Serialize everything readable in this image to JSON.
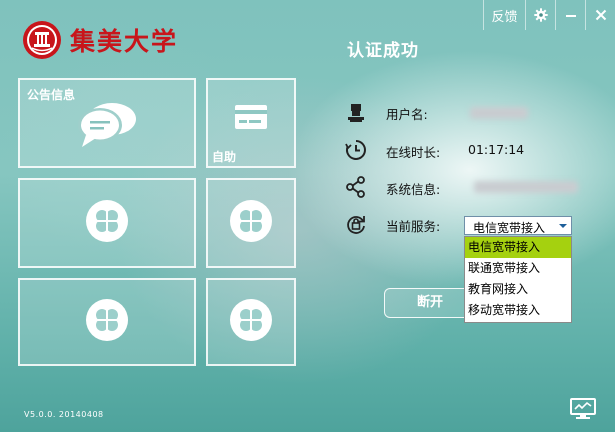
{
  "window": {
    "feedback_label": "反馈",
    "settings_icon": "gear-icon",
    "minimize_icon": "minimize-icon",
    "close_icon": "close-icon"
  },
  "brand": {
    "university_name": "集美大学",
    "seal_color": "#c8151b"
  },
  "tiles": {
    "notice_label": "公告信息",
    "self_service_label": "自助",
    "placeholder_icon": "clover-icon"
  },
  "status": {
    "title": "认证成功",
    "username_label": "用户名:",
    "online_time_label": "在线时长:",
    "online_time_value": "01:17:14",
    "system_info_label": "系统信息:",
    "current_service_label": "当前服务:",
    "selected_service": "电信宽带接入",
    "service_options": [
      "电信宽带接入",
      "联通宽带接入",
      "教育网接入",
      "移动宽带接入"
    ],
    "disconnect_label": "断开"
  },
  "colors": {
    "accent_green": "#a5d10f",
    "brand_red": "#c8151b"
  },
  "footer": {
    "version": "V5.0.0. 20140408",
    "network_icon": "network-monitor-icon"
  }
}
